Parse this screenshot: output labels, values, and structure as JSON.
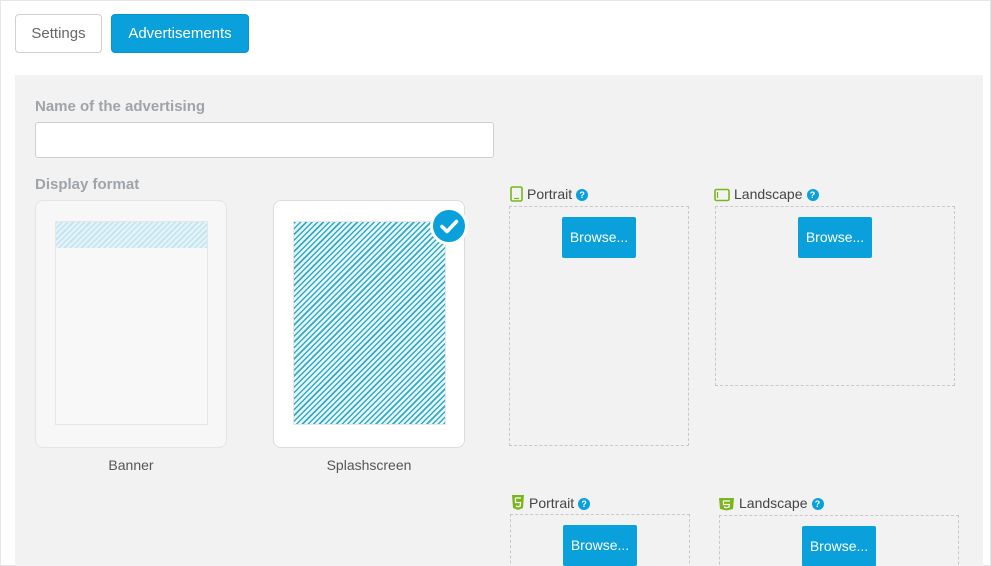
{
  "tabs": {
    "settings_label": "Settings",
    "advertisements_label": "Advertisements"
  },
  "form": {
    "name_label": "Name of the advertising",
    "name_value": "",
    "name_placeholder": "",
    "display_format_label": "Display format"
  },
  "formats": [
    {
      "label": "Banner",
      "selected": false
    },
    {
      "label": "Splashscreen",
      "selected": true
    }
  ],
  "upload_slots": {
    "native_portrait_label": "Portrait",
    "native_landscape_label": "Landscape",
    "html5_portrait_label": "Portrait",
    "html5_landscape_label": "Landscape",
    "browse_label": "Browse..."
  },
  "colors": {
    "accent": "#0aa0dc",
    "device_icon": "#7ab51d",
    "html5_icon": "#7ab51d",
    "panel_bg": "#f2f2f2"
  },
  "icons": {
    "help": "question-circle-icon",
    "check": "check-circle-icon",
    "portrait": "phone-portrait-icon",
    "landscape": "phone-landscape-icon",
    "html5": "html5-icon"
  }
}
